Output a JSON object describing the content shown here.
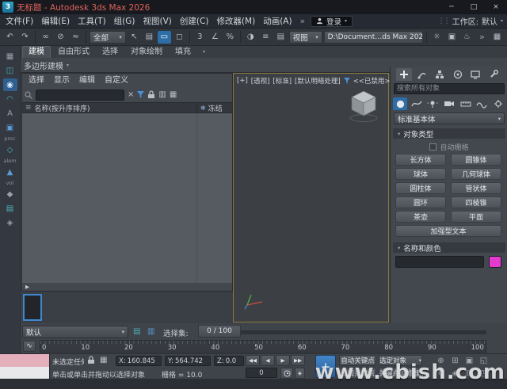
{
  "window": {
    "title": "无标题 - Autodesk 3ds Max 2026",
    "minimize": "─",
    "maximize": "□",
    "close": "×"
  },
  "menu_bar": {
    "items": [
      "文件(F)",
      "编辑(E)",
      "工具(T)",
      "组(G)",
      "视图(V)",
      "创建(C)",
      "修改器(M)",
      "动画(A)"
    ],
    "sign_in": "登录",
    "workspace_label": "工作区:",
    "workspace_value": "默认"
  },
  "toolbar": {
    "selection_filter": "全部",
    "view_dropdown": "视图",
    "project_path": "D:\\Document…ds Max 2026"
  },
  "ribbon": {
    "tabs": [
      "建模",
      "自由形式",
      "选择",
      "对象绘制",
      "填充"
    ],
    "panel_label": "多边形建模"
  },
  "left_strip": {
    "items": [
      "▦",
      "◫",
      "◉",
      "◠",
      "A",
      "▣",
      "proc",
      "◇",
      "alem",
      "▲",
      "vol",
      "◆",
      "▤",
      "◈"
    ]
  },
  "scene_explorer": {
    "menus": [
      "选择",
      "显示",
      "编辑",
      "自定义"
    ],
    "search_placeholder": "",
    "name_header": "名称(按升序排序)",
    "frozen_header": "冻结"
  },
  "viewport": {
    "label_plus": "[+]",
    "label_view": "[透视]",
    "label_standard": "[标准]",
    "label_shading": "[默认明暗处理]",
    "label_disabled": "<<已禁用>>"
  },
  "command_panel": {
    "search_placeholder": "搜索所有对象",
    "subcategory": "标准基本体",
    "object_type_rollout": "对象类型",
    "autogrid": "自动栅格",
    "buttons": [
      "长方体",
      "圆锥体",
      "球体",
      "几何球体",
      "圆柱体",
      "管状体",
      "圆环",
      "四棱锥",
      "茶壶",
      "平面",
      "加强型文本"
    ],
    "name_color_rollout": "名称和颜色",
    "color_swatch": "#e23bce"
  },
  "selection_sets": {
    "value": "默认",
    "label": "选择集:"
  },
  "time_slider": {
    "value": "0 / 100"
  },
  "timeline": {
    "ticks": [
      "0",
      "10",
      "20",
      "30",
      "40",
      "50",
      "60",
      "70",
      "80",
      "90",
      "100"
    ]
  },
  "status_bar": {
    "status_line": "未选定任何对象",
    "prompt_line": "单击或单击并拖动以选择对象",
    "x_label": "X:",
    "x_value": "160.845",
    "y_label": "Y:",
    "y_value": "564.742",
    "z_label": "Z:",
    "z_value": "0.0",
    "grid_info": "栅格 = 10.0",
    "frame_field": "0"
  },
  "animation_controls": {
    "auto_key": "自动关键点",
    "selection_scope": "选定对象",
    "set_key": "设置关键点",
    "key_filters": "关键点过滤器..."
  },
  "watermark": "www.cbish.com",
  "icons": {
    "undo": "↶",
    "redo": "↷",
    "link": "∞",
    "unlink": "⊘",
    "bind": "≈",
    "select": "↖",
    "select_by_name": "▤",
    "region": "▭",
    "crossing": "◻",
    "snap3": "3",
    "snap_angle": "∠",
    "snap_percent": "%",
    "mirror": "◑",
    "align": "≡",
    "layers": "▤",
    "render_setup": "☼",
    "render_frame": "▣",
    "render": "♨",
    "overflow": "»",
    "dropdown": "▾",
    "grip": "⋮⋮",
    "close_small": "×",
    "hamburger": "≡",
    "snowflake": "❄",
    "go_start": "◀◀",
    "prev_frame": "◀",
    "play": "▶",
    "go_end": "▶▶",
    "curve": "∿",
    "expand_right": "▶",
    "plus": "+",
    "col_a": "▥",
    "col_b": "▦",
    "sel_icon_a": "▤",
    "sel_icon_b": "▥",
    "nav1": "⊕",
    "nav2": "⊞",
    "nav3": "▣",
    "nav4": "◱",
    "nav5": "↻",
    "nav6": "◈",
    "nav7": "⊟",
    "nav8": "◳"
  }
}
